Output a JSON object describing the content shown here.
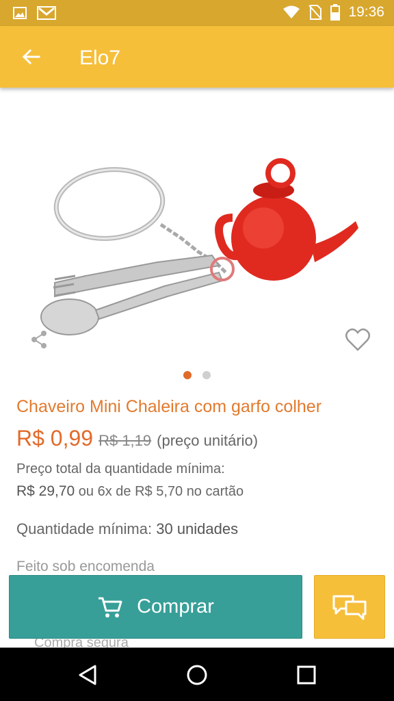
{
  "status_bar": {
    "time": "19:36",
    "icons": [
      "image-icon",
      "gmail-icon",
      "wifi-icon",
      "no-sim-icon",
      "battery-icon"
    ]
  },
  "app_bar": {
    "title": "Elo7",
    "back_icon": "arrow-left-icon"
  },
  "gallery": {
    "image_subject": "keychain-teapot-fork-spoon",
    "page_count": 2,
    "active_page": 1
  },
  "product": {
    "name": "Chaveiro Mini Chaleira com garfo colher",
    "price": "R$ 0,99",
    "old_price": "R$ 1,19",
    "unit_note": "(preço unitário)",
    "total_label": "Preço total da quantidade mínima:",
    "total_price": "R$ 29,70",
    "installments": "ou 6x de R$ 5,70 no cartão",
    "min_qty_label": "Quantidade mínima:",
    "min_qty_value": "30 unidades",
    "made_to_order": "Feito sob encomenda",
    "secure_purchase": "Compra segura"
  },
  "actions": {
    "buy_label": "Comprar",
    "buy_icon": "cart-icon",
    "chat_icon": "chat-bubbles-icon"
  },
  "colors": {
    "status_bar": "#d8a72e",
    "app_bar": "#f6bf3a",
    "accent_orange": "#e26a2a",
    "buy_button": "#379f98"
  }
}
